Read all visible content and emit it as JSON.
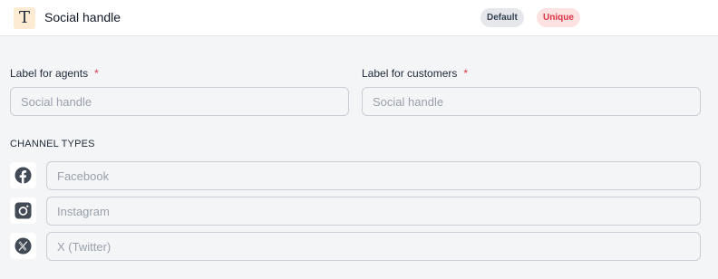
{
  "header": {
    "type_icon": "text-type-icon",
    "type_glyph": "T",
    "title": "Social handle",
    "badges": {
      "default": "Default",
      "unique": "Unique"
    }
  },
  "fields": {
    "agents": {
      "label": "Label for agents",
      "required_mark": "*",
      "placeholder": "Social handle",
      "value": ""
    },
    "customers": {
      "label": "Label for customers",
      "required_mark": "*",
      "placeholder": "Social handle",
      "value": ""
    }
  },
  "channels": {
    "title": "CHANNEL TYPES",
    "items": [
      {
        "icon": "facebook-icon",
        "placeholder": "Facebook",
        "value": ""
      },
      {
        "icon": "instagram-icon",
        "placeholder": "Instagram",
        "value": ""
      },
      {
        "icon": "x-twitter-icon",
        "placeholder": "X (Twitter)",
        "value": ""
      }
    ]
  },
  "colors": {
    "required": "#dc3545",
    "unique_badge_bg": "#fde2e2",
    "default_badge_bg": "#e5e7eb",
    "type_icon_bg": "#fdebd3",
    "channel_icon": "#414a55"
  }
}
